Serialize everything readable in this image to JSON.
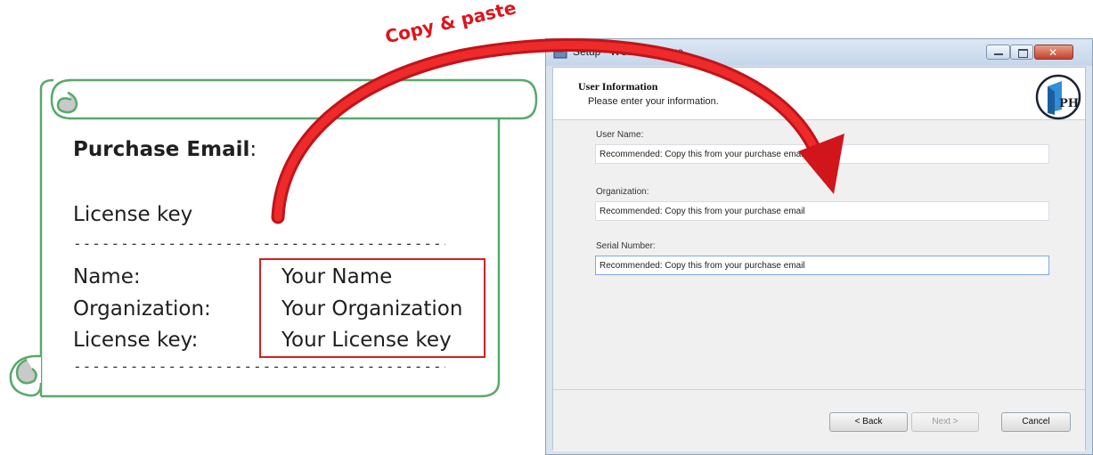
{
  "annotation": {
    "copy_paste_label": "Copy & paste",
    "arrow_color": "#e0131b"
  },
  "email_scroll": {
    "purchase_email_label": "Purchase Email",
    "purchase_email_colon": ":",
    "license_key_heading": "License key",
    "divider": "-----------------------------------------------",
    "fields": [
      {
        "label": "Name:",
        "value": "Your Name"
      },
      {
        "label": "Organization:",
        "value": "Your Organization"
      },
      {
        "label": "License key:",
        "value": "Your License key"
      }
    ],
    "scroll_color": "#5aa86c",
    "highlight_color": "#d42020"
  },
  "setup_window": {
    "title": "Setup - WURSH Image",
    "icon": "setup-installer-icon",
    "header": {
      "title": "User Information",
      "subtitle": "Please enter your information.",
      "logo_text": "PH"
    },
    "fields": {
      "user_name": {
        "label": "User Name:",
        "value": "Recommended: Copy this from your purchase email"
      },
      "organization": {
        "label": "Organization:",
        "value": "Recommended: Copy this from your purchase email"
      },
      "serial_number": {
        "label": "Serial Number:",
        "value": "Recommended: Copy this from your purchase email"
      }
    },
    "buttons": {
      "back": "< Back",
      "next": "Next >",
      "cancel": "Cancel"
    }
  }
}
